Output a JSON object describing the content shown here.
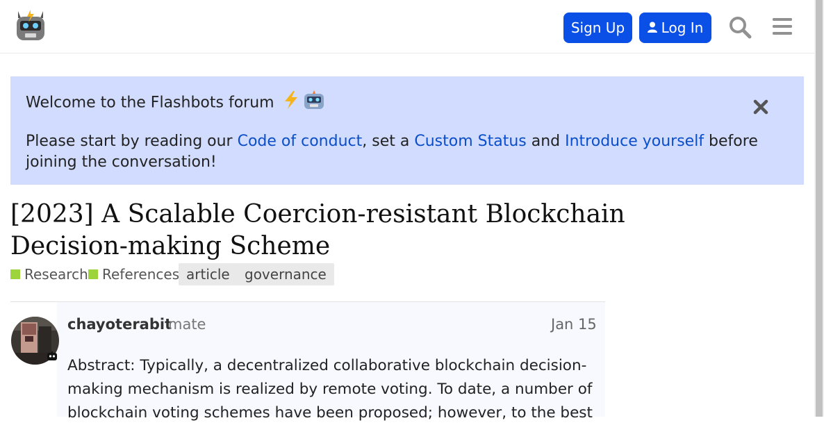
{
  "header": {
    "logo_icon": "flashbots-robot-logo",
    "signup_label": "Sign Up",
    "login_label": "Log In",
    "search_icon": "search-icon",
    "menu_icon": "hamburger-menu-icon",
    "accent_color": "#0a50e6"
  },
  "banner": {
    "welcome_text": "Welcome to the Flashbots forum",
    "welcome_emoji": [
      "lightning-emoji",
      "robot-emoji"
    ],
    "intro_text": "Please start by reading our ",
    "link_conduct": "Code of conduct",
    "sep1": ", set a ",
    "link_status": "Custom Status",
    "sep2": " and ",
    "link_introduce": "Introduce yourself",
    "outro_text": " before joining the conversation!",
    "background_color": "#d1dcfe"
  },
  "topic": {
    "title": "[2023] A Scalable Coercion-resistant Blockchain Decision-making Scheme",
    "categories": [
      {
        "label": "Research",
        "color": "#9ed43b"
      },
      {
        "label": "References",
        "color": "#9ed43b"
      }
    ],
    "tags": [
      "article",
      "governance"
    ]
  },
  "post": {
    "username": "chayoterabit",
    "user_title": "mate",
    "date": "Jan 15",
    "body": "Abstract: Typically, a decentralized collaborative blockchain decision-making mechanism is realized by remote voting. To date, a number of blockchain voting schemes have been proposed; however, to the best"
  }
}
